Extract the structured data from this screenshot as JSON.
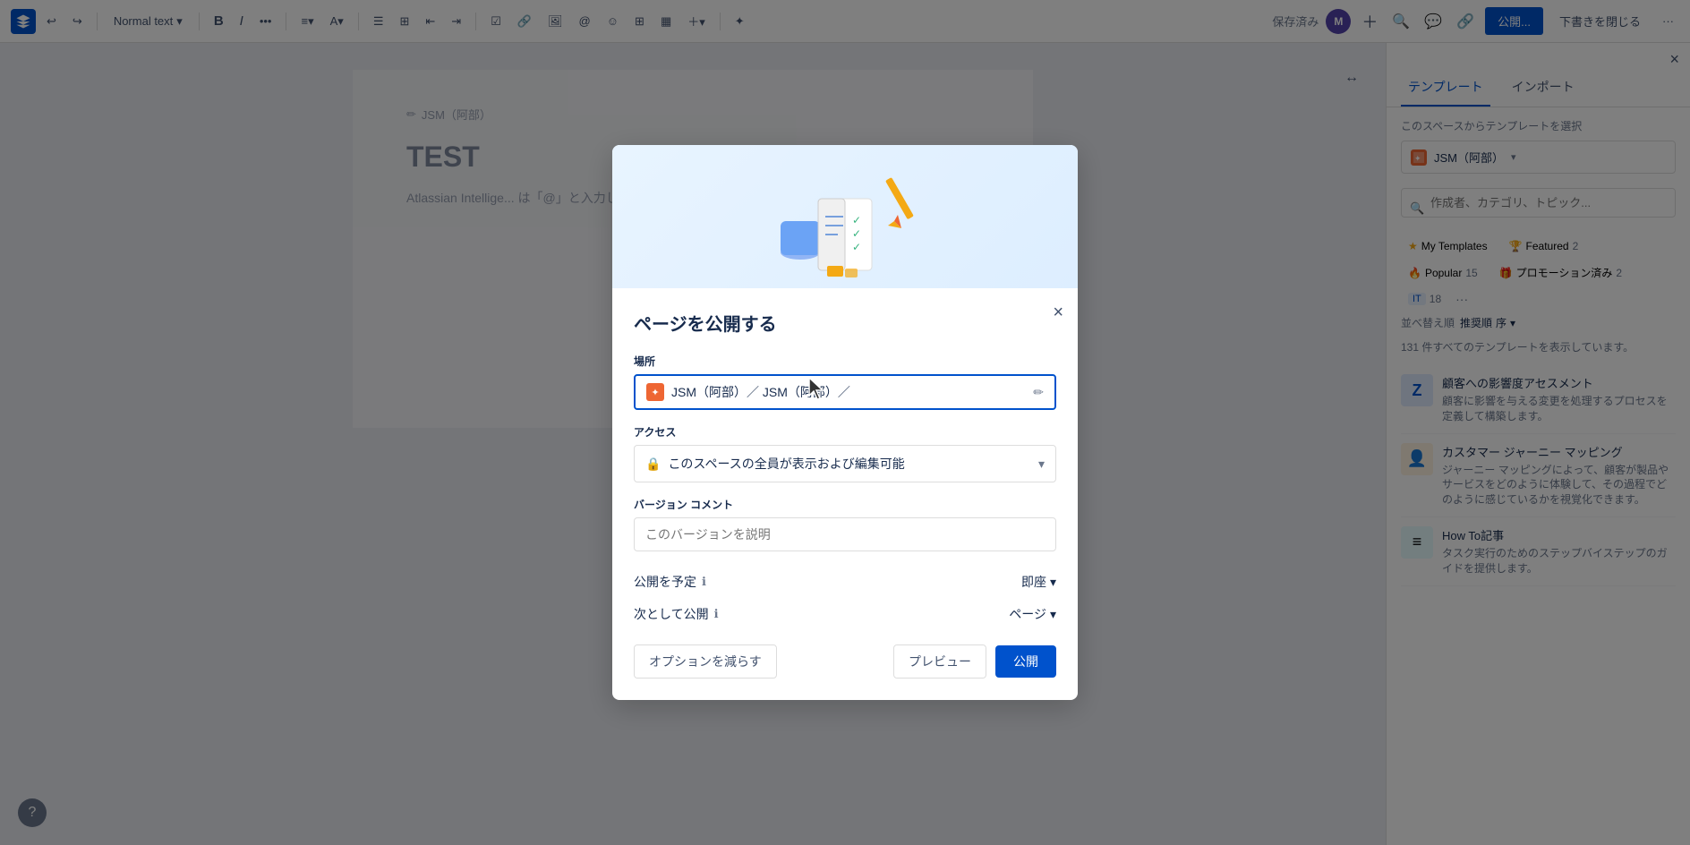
{
  "toolbar": {
    "undo_label": "↩",
    "redo_label": "↪",
    "text_style": "Normal text",
    "bold_label": "B",
    "italic_label": "I",
    "more_label": "•••",
    "save_status": "保存済み",
    "publish_btn": "公開...",
    "close_draft_btn": "下書きを閉じる",
    "more_menu": "···"
  },
  "breadcrumb": {
    "edit_icon": "✏",
    "path": "JSM（阿部）"
  },
  "editor": {
    "title": "TEST",
    "body": "Atlassian Intellige... は「@」と入力します（メンシ..."
  },
  "sidebar": {
    "tab_template": "テンプレート",
    "tab_import": "インポート",
    "close_label": "×",
    "space_label": "このスペースからテンプレートを選択",
    "space_name": "JSM（阿部）",
    "search_placeholder": "作成者、カテゴリ、トピック...",
    "my_templates_label": "My Templates",
    "featured_label": "Featured",
    "featured_count": "2",
    "popular_label": "Popular",
    "popular_count": "15",
    "promo_label": "プロモーション済み",
    "promo_count": "2",
    "it_label": "IT",
    "it_count": "18",
    "more_filters": "···",
    "sort_label": "並べ替え順",
    "sort_value": "推奨順",
    "sort_suffix": "序",
    "template_count_text": "131 件すべてのテンプレートを表示しています。",
    "templates": [
      {
        "id": 1,
        "icon_type": "blue",
        "icon_char": "Z",
        "title": "顧客への影響度アセスメント",
        "description": "顧客に影響を与える変更を処理するプロセスを定義して構築します。"
      },
      {
        "id": 2,
        "icon_type": "orange",
        "icon_char": "👤",
        "title": "カスタマー ジャーニー マッピング",
        "description": "ジャーニー マッピングによって、顧客が製品やサービスをどのように体験して、その過程でどのように感じているかを視覚化できます。"
      },
      {
        "id": 3,
        "icon_type": "teal",
        "icon_char": "≡",
        "title": "How To記事",
        "description": "タスク実行のためのステップバイステップのガイドを提供します。"
      }
    ]
  },
  "modal": {
    "title": "ページを公開する",
    "close_label": "×",
    "location_label": "場所",
    "location_value": "JSM（阿部）／ JSM（阿部）／",
    "access_label": "アクセス",
    "access_value": "このスペースの全員が表示および編集可能",
    "version_comment_label": "バージョン コメント",
    "version_comment_placeholder": "このバージョンを説明",
    "schedule_label": "公開を予定",
    "schedule_value": "即座",
    "publish_as_label": "次として公開",
    "publish_as_value": "ページ",
    "reduce_options_btn": "オプションを減らす",
    "preview_btn": "プレビュー",
    "publish_btn": "公開"
  }
}
